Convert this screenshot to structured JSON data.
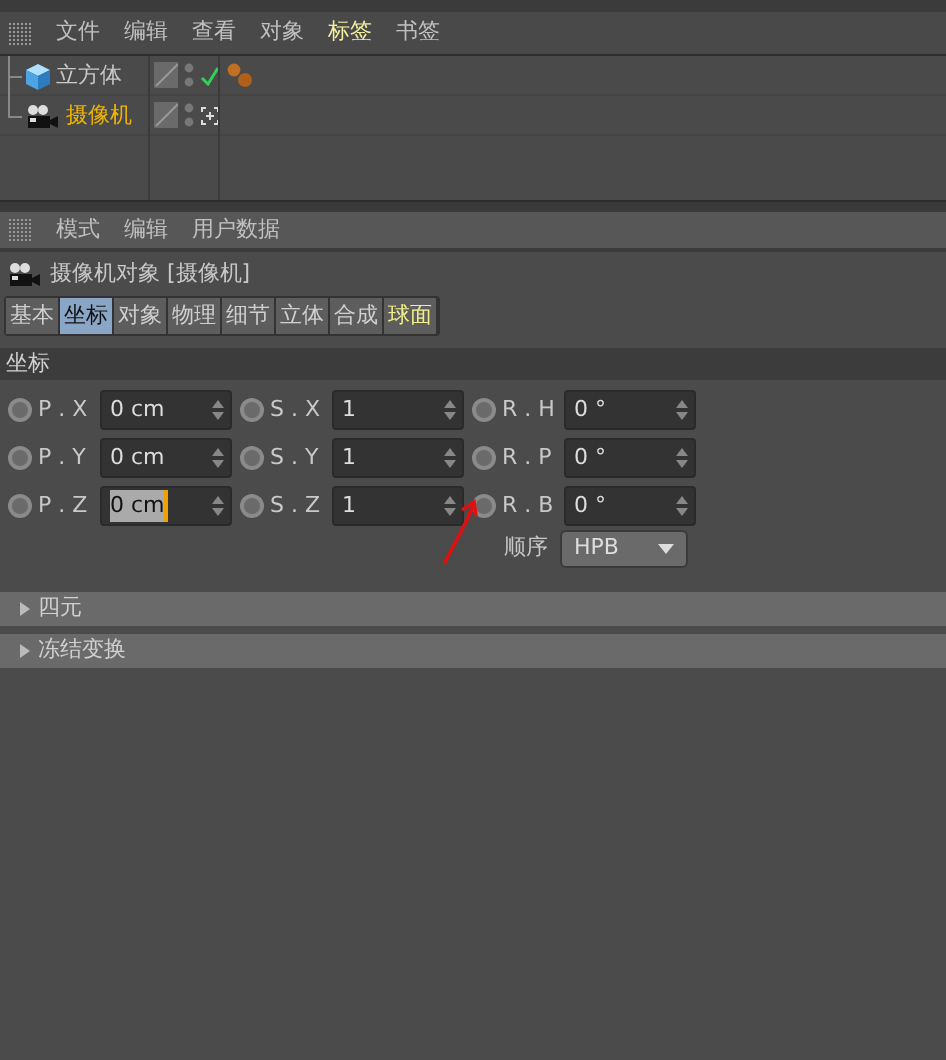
{
  "menu": [
    {
      "label": "文件",
      "selected": false
    },
    {
      "label": "编辑",
      "selected": false
    },
    {
      "label": "查看",
      "selected": false
    },
    {
      "label": "对象",
      "selected": false
    },
    {
      "label": "标签",
      "selected": true
    },
    {
      "label": "书签",
      "selected": false
    }
  ],
  "objects": [
    {
      "name": "立方体",
      "kind": "cube",
      "selected": false,
      "status": {
        "kind": "check"
      },
      "tags": [
        {
          "kind": "spheres"
        }
      ]
    },
    {
      "name": "摄像机",
      "kind": "camera",
      "selected": true,
      "status": {
        "kind": "target"
      }
    }
  ],
  "attr_menu": [
    "模式",
    "编辑",
    "用户数据"
  ],
  "object_title": "摄像机对象 [摄像机]",
  "tabs": [
    {
      "label": "基本",
      "selected": false,
      "highlighted": false
    },
    {
      "label": "坐标",
      "selected": true,
      "highlighted": false
    },
    {
      "label": "对象",
      "selected": false,
      "highlighted": false
    },
    {
      "label": "物理",
      "selected": false,
      "highlighted": false
    },
    {
      "label": "细节",
      "selected": false,
      "highlighted": false
    },
    {
      "label": "立体",
      "selected": false,
      "highlighted": false
    },
    {
      "label": "合成",
      "selected": false,
      "highlighted": false
    },
    {
      "label": "球面",
      "selected": false,
      "highlighted": true
    }
  ],
  "section": "坐标",
  "rows": [
    [
      {
        "label": "P . X",
        "value": "0 cm",
        "focused": false,
        "keyed": false
      },
      {
        "label": "S . X",
        "value": "1",
        "focused": false,
        "keyed": false
      },
      {
        "label": "R . H",
        "value": "0 °",
        "focused": false,
        "keyed": false
      }
    ],
    [
      {
        "label": "P . Y",
        "value": "0 cm",
        "focused": false,
        "keyed": false
      },
      {
        "label": "S . Y",
        "value": "1",
        "focused": false,
        "keyed": false
      },
      {
        "label": "R . P",
        "value": "0 °",
        "focused": false,
        "keyed": false
      }
    ],
    [
      {
        "label": "P . Z",
        "value": "0 cm",
        "focused": true,
        "keyed": false
      },
      {
        "label": "S . Z",
        "value": "1",
        "focused": false,
        "keyed": false
      },
      {
        "label": "R . B",
        "value": "0 °",
        "focused": false,
        "keyed": false
      }
    ]
  ],
  "order": {
    "label": "顺序",
    "value": "HPB"
  },
  "groups": [
    {
      "label": "四元",
      "expanded": false
    },
    {
      "label": "冻结变换",
      "expanded": false
    }
  ]
}
